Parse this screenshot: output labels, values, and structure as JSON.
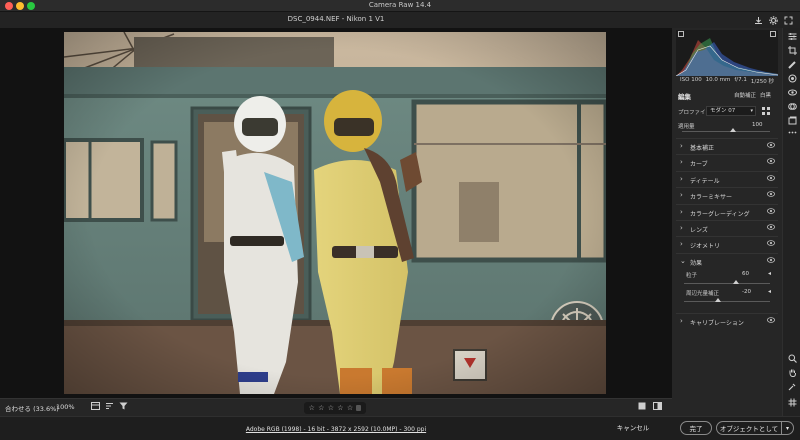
{
  "window": {
    "title": "Camera Raw 14.4"
  },
  "document": {
    "title": "DSC_0944.NEF  -  Nikon 1 V1"
  },
  "header_icons": [
    "save-icon",
    "settings-gear-icon",
    "fullscreen-icon"
  ],
  "exif": {
    "iso": "ISO 100",
    "focal": "10.0 mm",
    "aperture": "f/7.1",
    "shutter": "1/250 秒"
  },
  "edit": {
    "title": "編集",
    "auto_label": "自動補正",
    "bw_label": "白黒",
    "profile_label": "プロファイル",
    "profile_value": "モダン 07",
    "amount_label": "適用量",
    "amount_value": "100",
    "amount_fraction": 1.0
  },
  "sections": [
    {
      "label": "基本補正",
      "expanded": false
    },
    {
      "label": "カーブ",
      "expanded": false
    },
    {
      "label": "ディテール",
      "expanded": false
    },
    {
      "label": "カラーミキサー",
      "expanded": false
    },
    {
      "label": "カラーグレーディング",
      "expanded": false
    },
    {
      "label": "レンズ",
      "expanded": false
    },
    {
      "label": "ジオメトリ",
      "expanded": false
    },
    {
      "label": "効果",
      "expanded": true
    },
    {
      "label": "キャリブレーション",
      "expanded": false
    }
  ],
  "effects": {
    "grain_label": "粒子",
    "grain_value": "60",
    "grain_fraction": 0.6,
    "vignette_label": "周辺光量補正",
    "vignette_value": "-20",
    "vignette_fraction": 0.4
  },
  "view": {
    "zoom_label": "合わせる (33.6%)",
    "zoom_pct": "100%",
    "stars": [
      "☆",
      "☆",
      "☆",
      "☆",
      "☆"
    ]
  },
  "status": {
    "workflow": "Adobe RGB (1998) - 16 bit - 3872 x 2592 (10.0MP) - 300 ppi",
    "cancel": "キャンセル",
    "done": "完了",
    "open": "オブジェクトとして開く",
    "open_arrow": "▾"
  },
  "tools": [
    "sliders-icon",
    "crop-icon",
    "healing-brush-icon",
    "masking-icon",
    "red-eye-icon",
    "presets-icon",
    "snapshots-icon",
    "more-icon",
    "zoom-icon",
    "hand-icon",
    "sampler-icon",
    "grid-icon"
  ],
  "colors": {
    "accent": "#3d8ee6",
    "panel": "#262626",
    "background": "#121212"
  }
}
